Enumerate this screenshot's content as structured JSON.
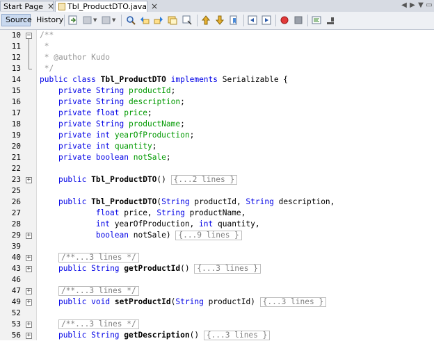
{
  "tabs": [
    {
      "label": "Start Page",
      "active": false
    },
    {
      "label": "Tbl_ProductDTO.java",
      "active": true
    }
  ],
  "toolbar": {
    "source_label": "Source",
    "history_label": "History"
  },
  "colors": {
    "keyword": "#0000e6",
    "field": "#009900",
    "comment": "#969696"
  },
  "icons": [
    "last-edit-icon",
    "back-icon",
    "forward-icon",
    "find-icon",
    "find-previous-icon",
    "find-next-icon",
    "toggle-highlight-icon",
    "find-selection-icon",
    "previous-bookmark-icon",
    "next-bookmark-icon",
    "toggle-bookmark-icon",
    "shift-left-icon",
    "shift-right-icon",
    "start-macro-icon",
    "stop-macro-icon",
    "comment-icon",
    "uncomment-icon"
  ],
  "lines": [
    {
      "n": "10",
      "fold": "minus",
      "t": "/**"
    },
    {
      "n": "11",
      "t": " *"
    },
    {
      "n": "12",
      "t": " * @author Kudo"
    },
    {
      "n": "13",
      "t": " */"
    },
    {
      "n": "14",
      "t": "public class Tbl_ProductDTO implements Serializable {"
    },
    {
      "n": "15",
      "t": "    private String productId;"
    },
    {
      "n": "16",
      "t": "    private String description;"
    },
    {
      "n": "17",
      "t": "    private float price;"
    },
    {
      "n": "18",
      "t": "    private String productName;"
    },
    {
      "n": "19",
      "t": "    private int yearOfProduction;"
    },
    {
      "n": "20",
      "t": "    private int quantity;"
    },
    {
      "n": "21",
      "t": "    private boolean notSale;"
    },
    {
      "n": "22",
      "t": ""
    },
    {
      "n": "23",
      "fold": "plus",
      "t": "    public Tbl_ProductDTO() {...2 lines }"
    },
    {
      "n": "25",
      "t": ""
    },
    {
      "n": "26",
      "t": "    public Tbl_ProductDTO(String productId, String description,"
    },
    {
      "n": "27",
      "t": "            float price, String productName,"
    },
    {
      "n": "28",
      "t": "            int yearOfProduction, int quantity,"
    },
    {
      "n": "29",
      "fold": "plus",
      "t": "            boolean notSale) {...9 lines }"
    },
    {
      "n": "39",
      "t": ""
    },
    {
      "n": "40",
      "fold": "plus",
      "t": "    /**...3 lines */"
    },
    {
      "n": "43",
      "fold": "plus",
      "t": "    public String getProductId() {...3 lines }"
    },
    {
      "n": "46",
      "t": ""
    },
    {
      "n": "47",
      "fold": "plus",
      "t": "    /**...3 lines */"
    },
    {
      "n": "49",
      "fold": "plus",
      "t": "    public void setProductId(String productId) {...3 lines }"
    },
    {
      "n": "52",
      "t": ""
    },
    {
      "n": "53",
      "fold": "plus",
      "t": "    /**...3 lines */"
    },
    {
      "n": "56",
      "fold": "plus",
      "t": "    public String getDescription() {...3 lines }"
    }
  ]
}
